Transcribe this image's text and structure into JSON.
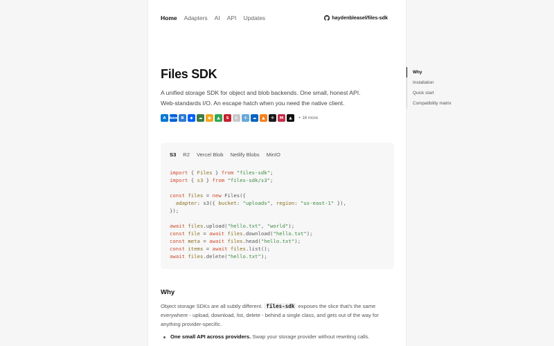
{
  "nav": {
    "items": [
      {
        "label": "Home",
        "active": true
      },
      {
        "label": "Adapters",
        "active": false
      },
      {
        "label": "AI",
        "active": false
      },
      {
        "label": "API",
        "active": false
      },
      {
        "label": "Updates",
        "active": false
      }
    ],
    "github_label": "haydenbleasel/files-sdk"
  },
  "hero": {
    "title": "Files SDK",
    "lede": "A unified storage SDK for object and blob backends. One small, honest API. Web-standards I/O. An escape hatch when you need the native client.",
    "more_label": "+ 16 more",
    "provider_icons": [
      {
        "name": "azure-icon",
        "glyph": "A",
        "color": "#0078d4"
      },
      {
        "name": "box-icon",
        "glyph": "box",
        "color": "#0061d5"
      },
      {
        "name": "backblaze-icon",
        "glyph": "B",
        "color": "#2e7bd6"
      },
      {
        "name": "dropbox-icon",
        "glyph": "◆",
        "color": "#0061fe"
      },
      {
        "name": "cloudflare-icon",
        "glyph": "☁",
        "color": "#3f7d44"
      },
      {
        "name": "bunny-icon",
        "glyph": "◉",
        "color": "#f5a623"
      },
      {
        "name": "google-drive-icon",
        "glyph": "▲",
        "color": "#34a853"
      },
      {
        "name": "aws-s3-icon",
        "glyph": "S",
        "color": "#c7202f"
      },
      {
        "name": "linode-icon",
        "glyph": "L",
        "color": "#c9c9c9"
      },
      {
        "name": "digitalocean-icon",
        "glyph": "✣",
        "color": "#69a8d8"
      },
      {
        "name": "onedrive-icon",
        "glyph": "☁",
        "color": "#0a66c2"
      },
      {
        "name": "firebase-icon",
        "glyph": "▲",
        "color": "#f58220"
      },
      {
        "name": "supabase-icon",
        "glyph": "✲",
        "color": "#1a1a1a"
      },
      {
        "name": "minio-icon",
        "glyph": "M",
        "color": "#c72e49"
      },
      {
        "name": "vercel-icon",
        "glyph": "▲",
        "color": "#111111"
      }
    ]
  },
  "code_card": {
    "tabs": [
      {
        "label": "S3",
        "active": true
      },
      {
        "label": "R2",
        "active": false
      },
      {
        "label": "Vercel Blob",
        "active": false
      },
      {
        "label": "Netlify Blobs",
        "active": false
      },
      {
        "label": "MinIO",
        "active": false
      }
    ]
  },
  "why": {
    "heading": "Why",
    "para_before": "Object storage SDKs are all subtly different.",
    "inline_code": "files-sdk",
    "para_after": "exposes the slice that's the same everywhere - upload, download, list, delete - behind a single class, and gets out of the way for anything provider-specific.",
    "bullet_bold": "One small API across providers.",
    "bullet_text": "Swap your storage provider without rewriting calls."
  },
  "toc": {
    "items": [
      {
        "label": "Why",
        "active": true
      },
      {
        "label": "Installation",
        "active": false
      },
      {
        "label": "Quick start",
        "active": false
      },
      {
        "label": "Compatibility matrix",
        "active": false
      }
    ]
  }
}
